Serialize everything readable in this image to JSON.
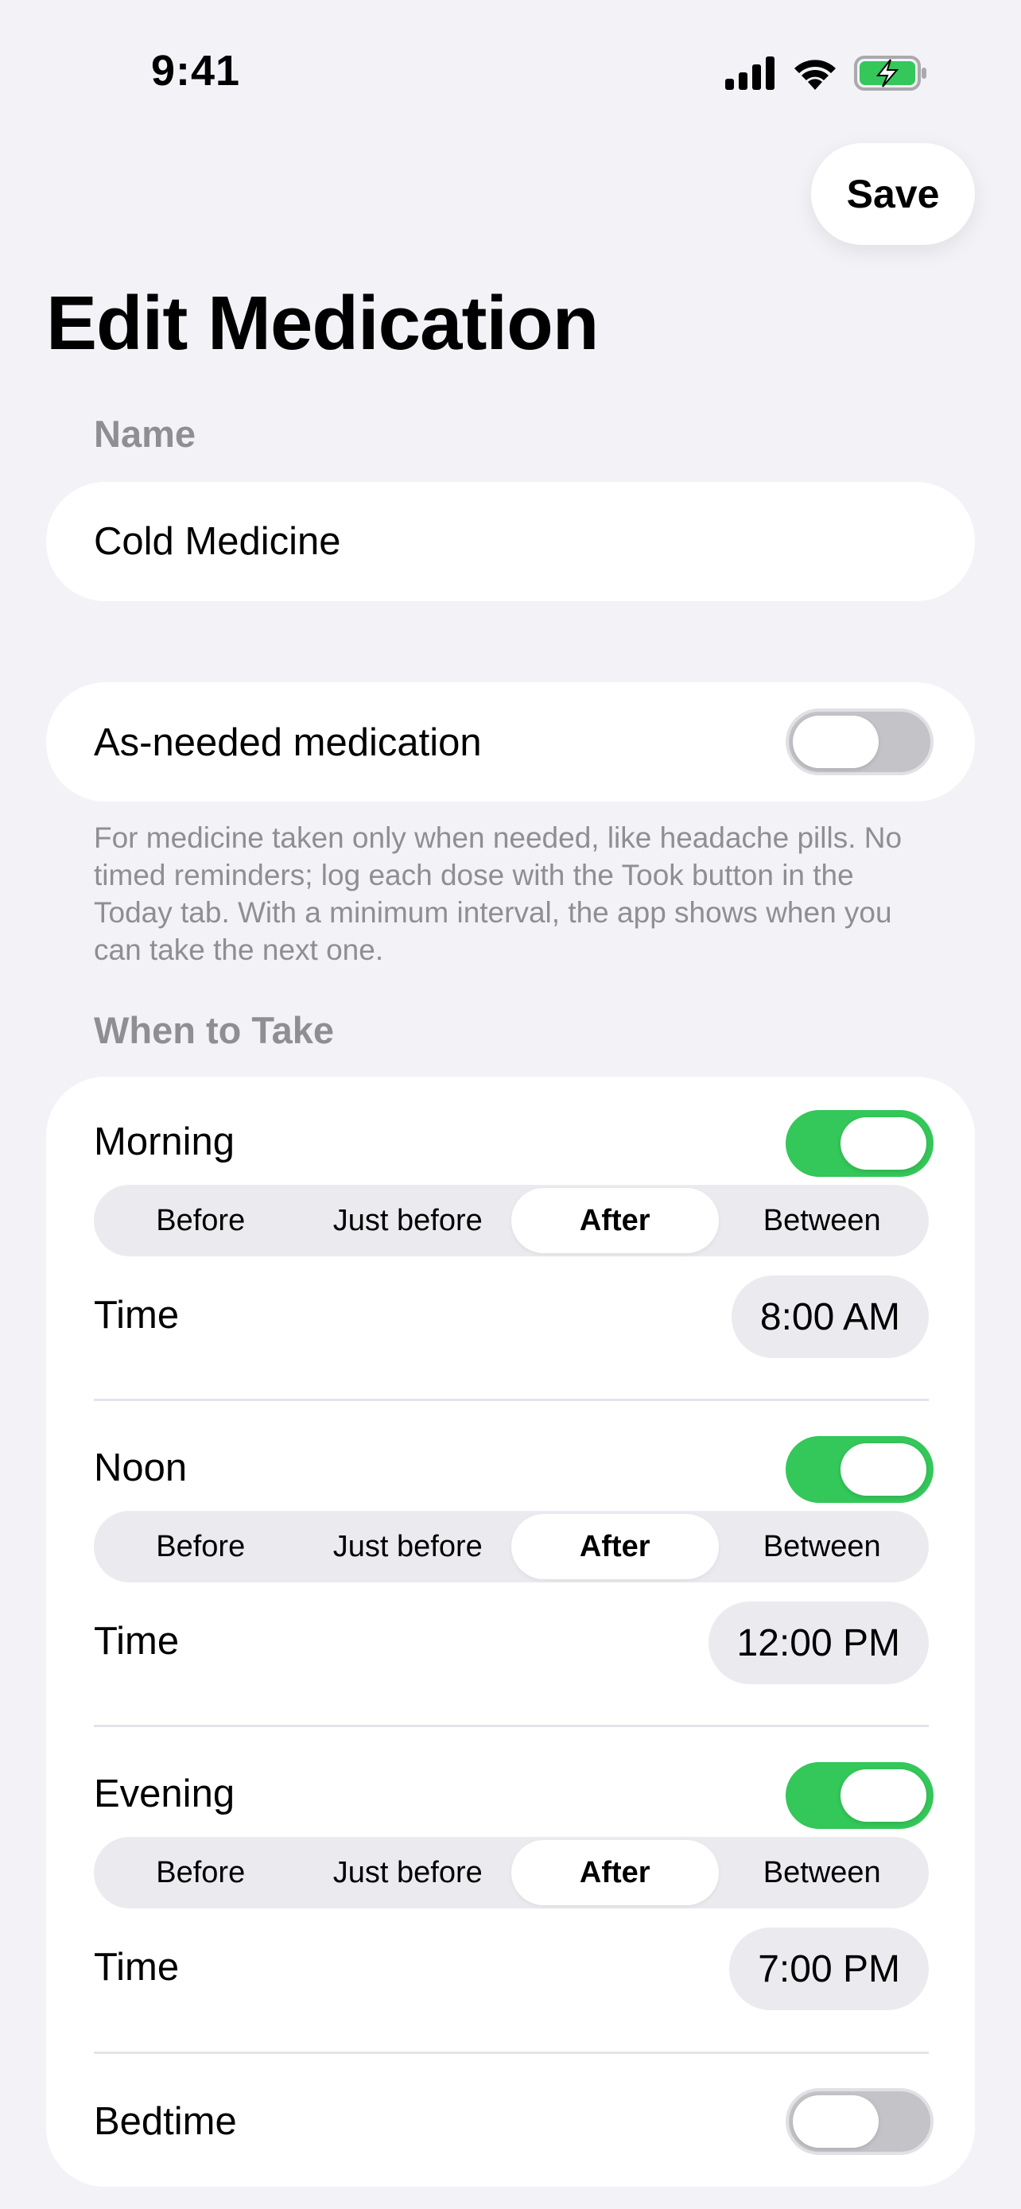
{
  "status_bar": {
    "time": "9:41"
  },
  "header": {
    "save_label": "Save",
    "title": "Edit Medication"
  },
  "name_section": {
    "label": "Name",
    "value": "Cold Medicine"
  },
  "as_needed": {
    "label": "As-needed medication",
    "enabled": false,
    "footnote": "For medicine taken only when needed, like headache pills. No timed reminders; log each dose with the Took button in the Today tab. With a minimum interval, the app shows when you can take the next one."
  },
  "when_to_take": {
    "label": "When to Take",
    "time_label": "Time",
    "timing_options": [
      "Before",
      "Just before",
      "After",
      "Between"
    ],
    "slots": [
      {
        "name": "Morning",
        "enabled": true,
        "timing": "After",
        "time": "8:00 AM"
      },
      {
        "name": "Noon",
        "enabled": true,
        "timing": "After",
        "time": "12:00 PM"
      },
      {
        "name": "Evening",
        "enabled": true,
        "timing": "After",
        "time": "7:00 PM"
      },
      {
        "name": "Bedtime",
        "enabled": false
      }
    ]
  },
  "colors": {
    "accent_green": "#34C759",
    "background": "#F2F2F7",
    "secondary_text": "#8E8E93"
  }
}
